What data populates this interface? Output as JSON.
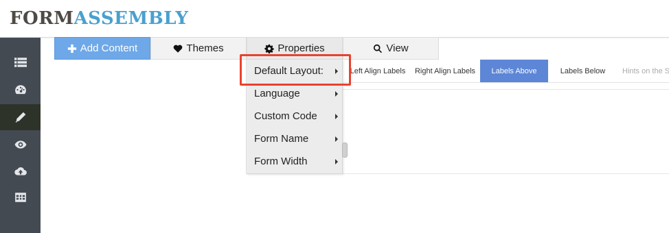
{
  "brand": {
    "part1": "FORM",
    "part2": "ASSEMBLY"
  },
  "sidebar": {
    "items": [
      {
        "icon": "list-icon",
        "active": false
      },
      {
        "icon": "dashboard-icon",
        "active": false
      },
      {
        "icon": "pencil-icon",
        "active": true
      },
      {
        "icon": "eye-icon",
        "active": false
      },
      {
        "icon": "cloud-upload-icon",
        "active": false
      },
      {
        "icon": "table-icon",
        "active": false
      }
    ]
  },
  "toolbar": {
    "add_content": "Add Content",
    "themes": "Themes",
    "properties": "Properties",
    "view": "View"
  },
  "properties_menu": {
    "items": [
      "Default Layout:",
      "Language",
      "Custom Code",
      "Form Name",
      "Form Width"
    ]
  },
  "layout_options": {
    "items": [
      "Left Align Labels",
      "Right Align Labels",
      "Labels Above",
      "Labels Below",
      "Hints on the S"
    ],
    "selected": "Labels Above"
  },
  "colors": {
    "accent": "#6ea8e8",
    "selected": "#5d86d6",
    "highlight": "#e8422f",
    "sidebar": "#444a52"
  }
}
